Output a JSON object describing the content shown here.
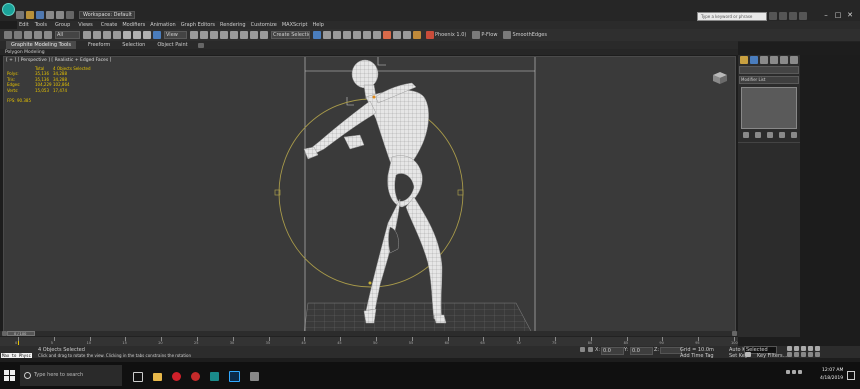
{
  "titlebar": {
    "logo": "3ds-max-logo",
    "workspace_label": "Workspace: Default",
    "search_placeholder": "Type a keyword or phrase"
  },
  "menu": [
    "Edit",
    "Tools",
    "Group",
    "Views",
    "Create",
    "Modifiers",
    "Animation",
    "Graph Editors",
    "Rendering",
    "Customize",
    "MAXScript",
    "Help"
  ],
  "toolbar": {
    "selection_filter": "All",
    "view_dropdown": "View",
    "named_selection": "Create Selection Se",
    "phoenix_label": "Phoenix 1.0)",
    "pflow_label": "P-Flow",
    "smooth_label": "SmoothEdges"
  },
  "ribbon": {
    "tabs": [
      "Graphite Modeling Tools",
      "Freeform",
      "Selection",
      "Object Paint"
    ],
    "sub_label": "Polygon Modeling"
  },
  "viewport": {
    "label": "[ + ] [ Perspective ] [ Realistic + Edged Faces ]",
    "stats_header": "Total",
    "stats_selected": "4 Objects Selected",
    "stats": [
      {
        "label": "Polys:",
        "total": "35,136",
        "sel": "34,288"
      },
      {
        "label": "Tris:",
        "total": "35,136",
        "sel": "34,288"
      },
      {
        "label": "Edges:",
        "total": "104,229",
        "sel": "102,864"
      },
      {
        "label": "Verts:",
        "total": "15,053",
        "sel": "17,474"
      }
    ],
    "fps_label": "FPS:",
    "fps_value": "90.385"
  },
  "command_panel": {
    "modifier_list": "Modifier List"
  },
  "timeline": {
    "frame_display": "0 / 100",
    "ticks": [
      "0",
      "5",
      "10",
      "15",
      "20",
      "25",
      "30",
      "35",
      "40",
      "45",
      "50",
      "55",
      "60",
      "65",
      "70",
      "75",
      "80",
      "85",
      "90",
      "95",
      "100"
    ]
  },
  "status": {
    "script_label": "Max to Physc",
    "selected_text": "4 Objects Selected",
    "prompt_text": "Click and drag to rotate the view.  Clicking in the tabs constrains the rotation",
    "x_label": "X:",
    "x_value": "0.0",
    "y_label": "Y:",
    "y_value": "0.0",
    "z_label": "Z:",
    "grid_text": "Grid = 10.0m",
    "autokey_label": "Auto Key",
    "selected_dropdown": "Selected",
    "setkey_label": "Set Key",
    "keyfilters_label": "Key Filters...",
    "addtimetag_label": "Add Time Tag"
  },
  "taskbar": {
    "search_placeholder": "Type here to search",
    "time": "12:07 AM",
    "date": "4/18/2019"
  },
  "colors": {
    "viewport_bg": "#3a3a3a",
    "stats_yellow": "#e8c400",
    "gizmo": "#a89a4a",
    "mesh_white": "#e8e8e8"
  }
}
